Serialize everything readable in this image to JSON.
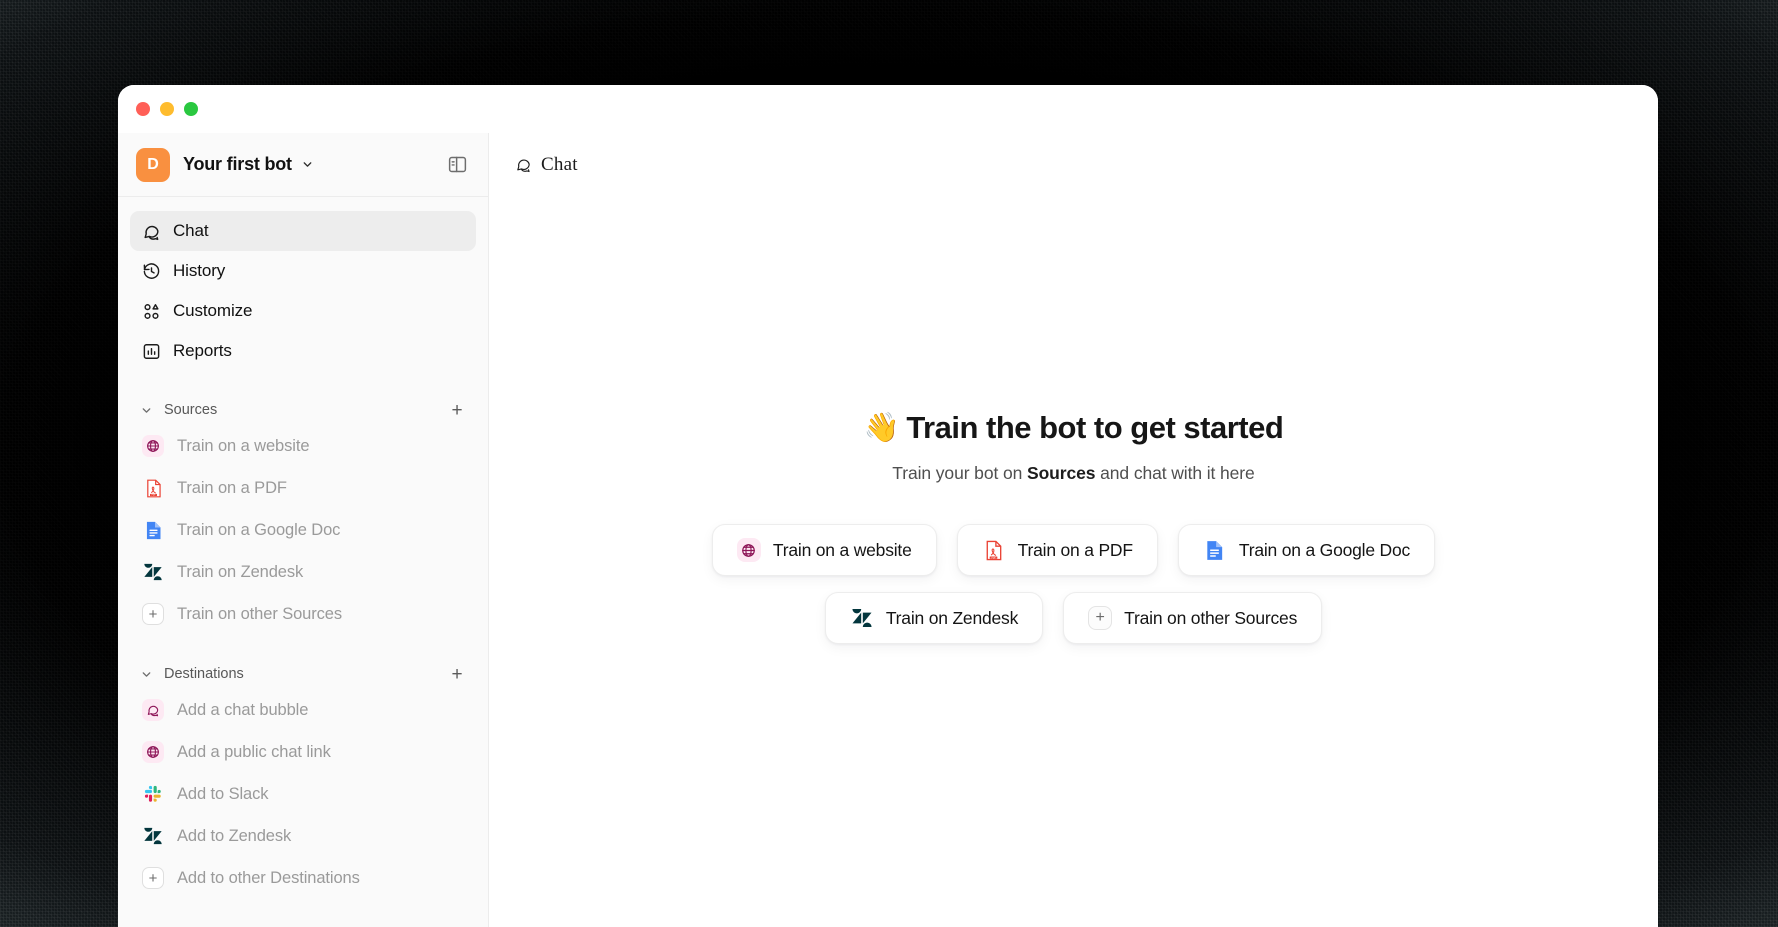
{
  "window": {
    "traffic_lights": [
      {
        "name": "close",
        "color": "#ff5f57"
      },
      {
        "name": "minimize",
        "color": "#febc2e"
      },
      {
        "name": "maximize",
        "color": "#2ac840"
      }
    ]
  },
  "sidebar": {
    "workspace": {
      "avatar_letter": "D",
      "avatar_color": "#f99040",
      "name": "Your first bot",
      "chevron_icon": "chevron-down-icon"
    },
    "panel_toggle_icon": "sidebar-toggle-icon",
    "nav": [
      {
        "id": "chat",
        "label": "Chat",
        "icon": "chat-bubbles-icon",
        "active": true
      },
      {
        "id": "history",
        "label": "History",
        "icon": "history-clock-icon",
        "active": false
      },
      {
        "id": "customize",
        "label": "Customize",
        "icon": "customize-nodes-icon",
        "active": false
      },
      {
        "id": "reports",
        "label": "Reports",
        "icon": "bar-chart-icon",
        "active": false
      }
    ],
    "sources": {
      "title": "Sources",
      "add_label": "+",
      "collapse_icon": "chevron-down-icon",
      "items": [
        {
          "label": "Train on a website",
          "icon": "globe-icon"
        },
        {
          "label": "Train on a PDF",
          "icon": "pdf-file-icon"
        },
        {
          "label": "Train on a Google Doc",
          "icon": "google-docs-icon"
        },
        {
          "label": "Train on Zendesk",
          "icon": "zendesk-icon"
        },
        {
          "label": "Train on other Sources",
          "icon": "plus-icon"
        }
      ]
    },
    "destinations": {
      "title": "Destinations",
      "add_label": "+",
      "collapse_icon": "chevron-down-icon",
      "items": [
        {
          "label": "Add a chat bubble",
          "icon": "chat-bubbles-icon"
        },
        {
          "label": "Add a public chat link",
          "icon": "globe-icon"
        },
        {
          "label": "Add to Slack",
          "icon": "slack-icon"
        },
        {
          "label": "Add to Zendesk",
          "icon": "zendesk-icon"
        },
        {
          "label": "Add to other Destinations",
          "icon": "plus-icon"
        }
      ]
    }
  },
  "main": {
    "header": {
      "title": "Chat",
      "icon": "chat-bubbles-icon"
    },
    "empty_state": {
      "emoji": "👋",
      "title": "Train the bot to get started",
      "subtitle_before": "Train your bot on ",
      "subtitle_bold": "Sources",
      "subtitle_after": " and chat with it here",
      "buttons_row1": [
        {
          "label": "Train on a website",
          "icon": "globe-icon"
        },
        {
          "label": "Train on a PDF",
          "icon": "pdf-file-icon"
        },
        {
          "label": "Train on a Google Doc",
          "icon": "google-docs-icon"
        }
      ],
      "buttons_row2": [
        {
          "label": "Train on Zendesk",
          "icon": "zendesk-icon"
        },
        {
          "label": "Train on other Sources",
          "icon": "plus-icon"
        }
      ]
    }
  },
  "colors": {
    "accent_orange": "#f99040",
    "pink_chip_bg": "#fde9f3",
    "pink_chip_fg": "#8e1658",
    "zendesk": "#03363d",
    "google_blue": "#4285f4",
    "pdf_red": "#ea4335",
    "sidebar_bg": "#fafafa",
    "active_item_bg": "#ededed"
  }
}
